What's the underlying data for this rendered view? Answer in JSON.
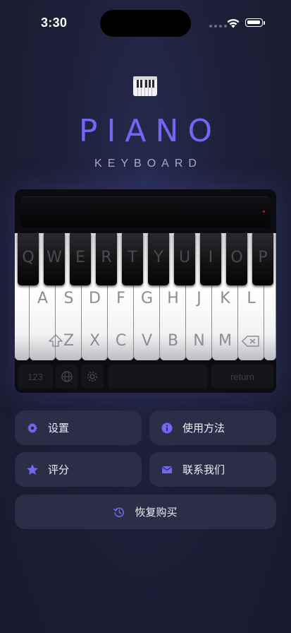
{
  "status": {
    "time": "3:30"
  },
  "app": {
    "title": "PIANO",
    "subtitle": "KEYBOARD"
  },
  "keyboard_preview": {
    "row1": [
      "Q",
      "W",
      "E",
      "R",
      "T",
      "Y",
      "U",
      "I",
      "O",
      "P"
    ],
    "row2": [
      "A",
      "S",
      "D",
      "F",
      "G",
      "H",
      "J",
      "K",
      "L"
    ],
    "row3": [
      "Z",
      "X",
      "C",
      "V",
      "B",
      "N",
      "M"
    ],
    "numbers_key": "123",
    "return_key": "return"
  },
  "menu": {
    "settings": "设置",
    "how_to_use": "使用方法",
    "rate": "评分",
    "contact_us": "联系我们",
    "restore_purchase": "恢复购买"
  },
  "colors": {
    "accent": "#6f68f2",
    "button_bg": "#2c2d47",
    "background": "#1d1f37"
  },
  "icons": {
    "settings": "gear-icon",
    "how_to_use": "info-icon",
    "rate": "star-icon",
    "contact_us": "envelope-icon",
    "restore_purchase": "history-icon"
  }
}
